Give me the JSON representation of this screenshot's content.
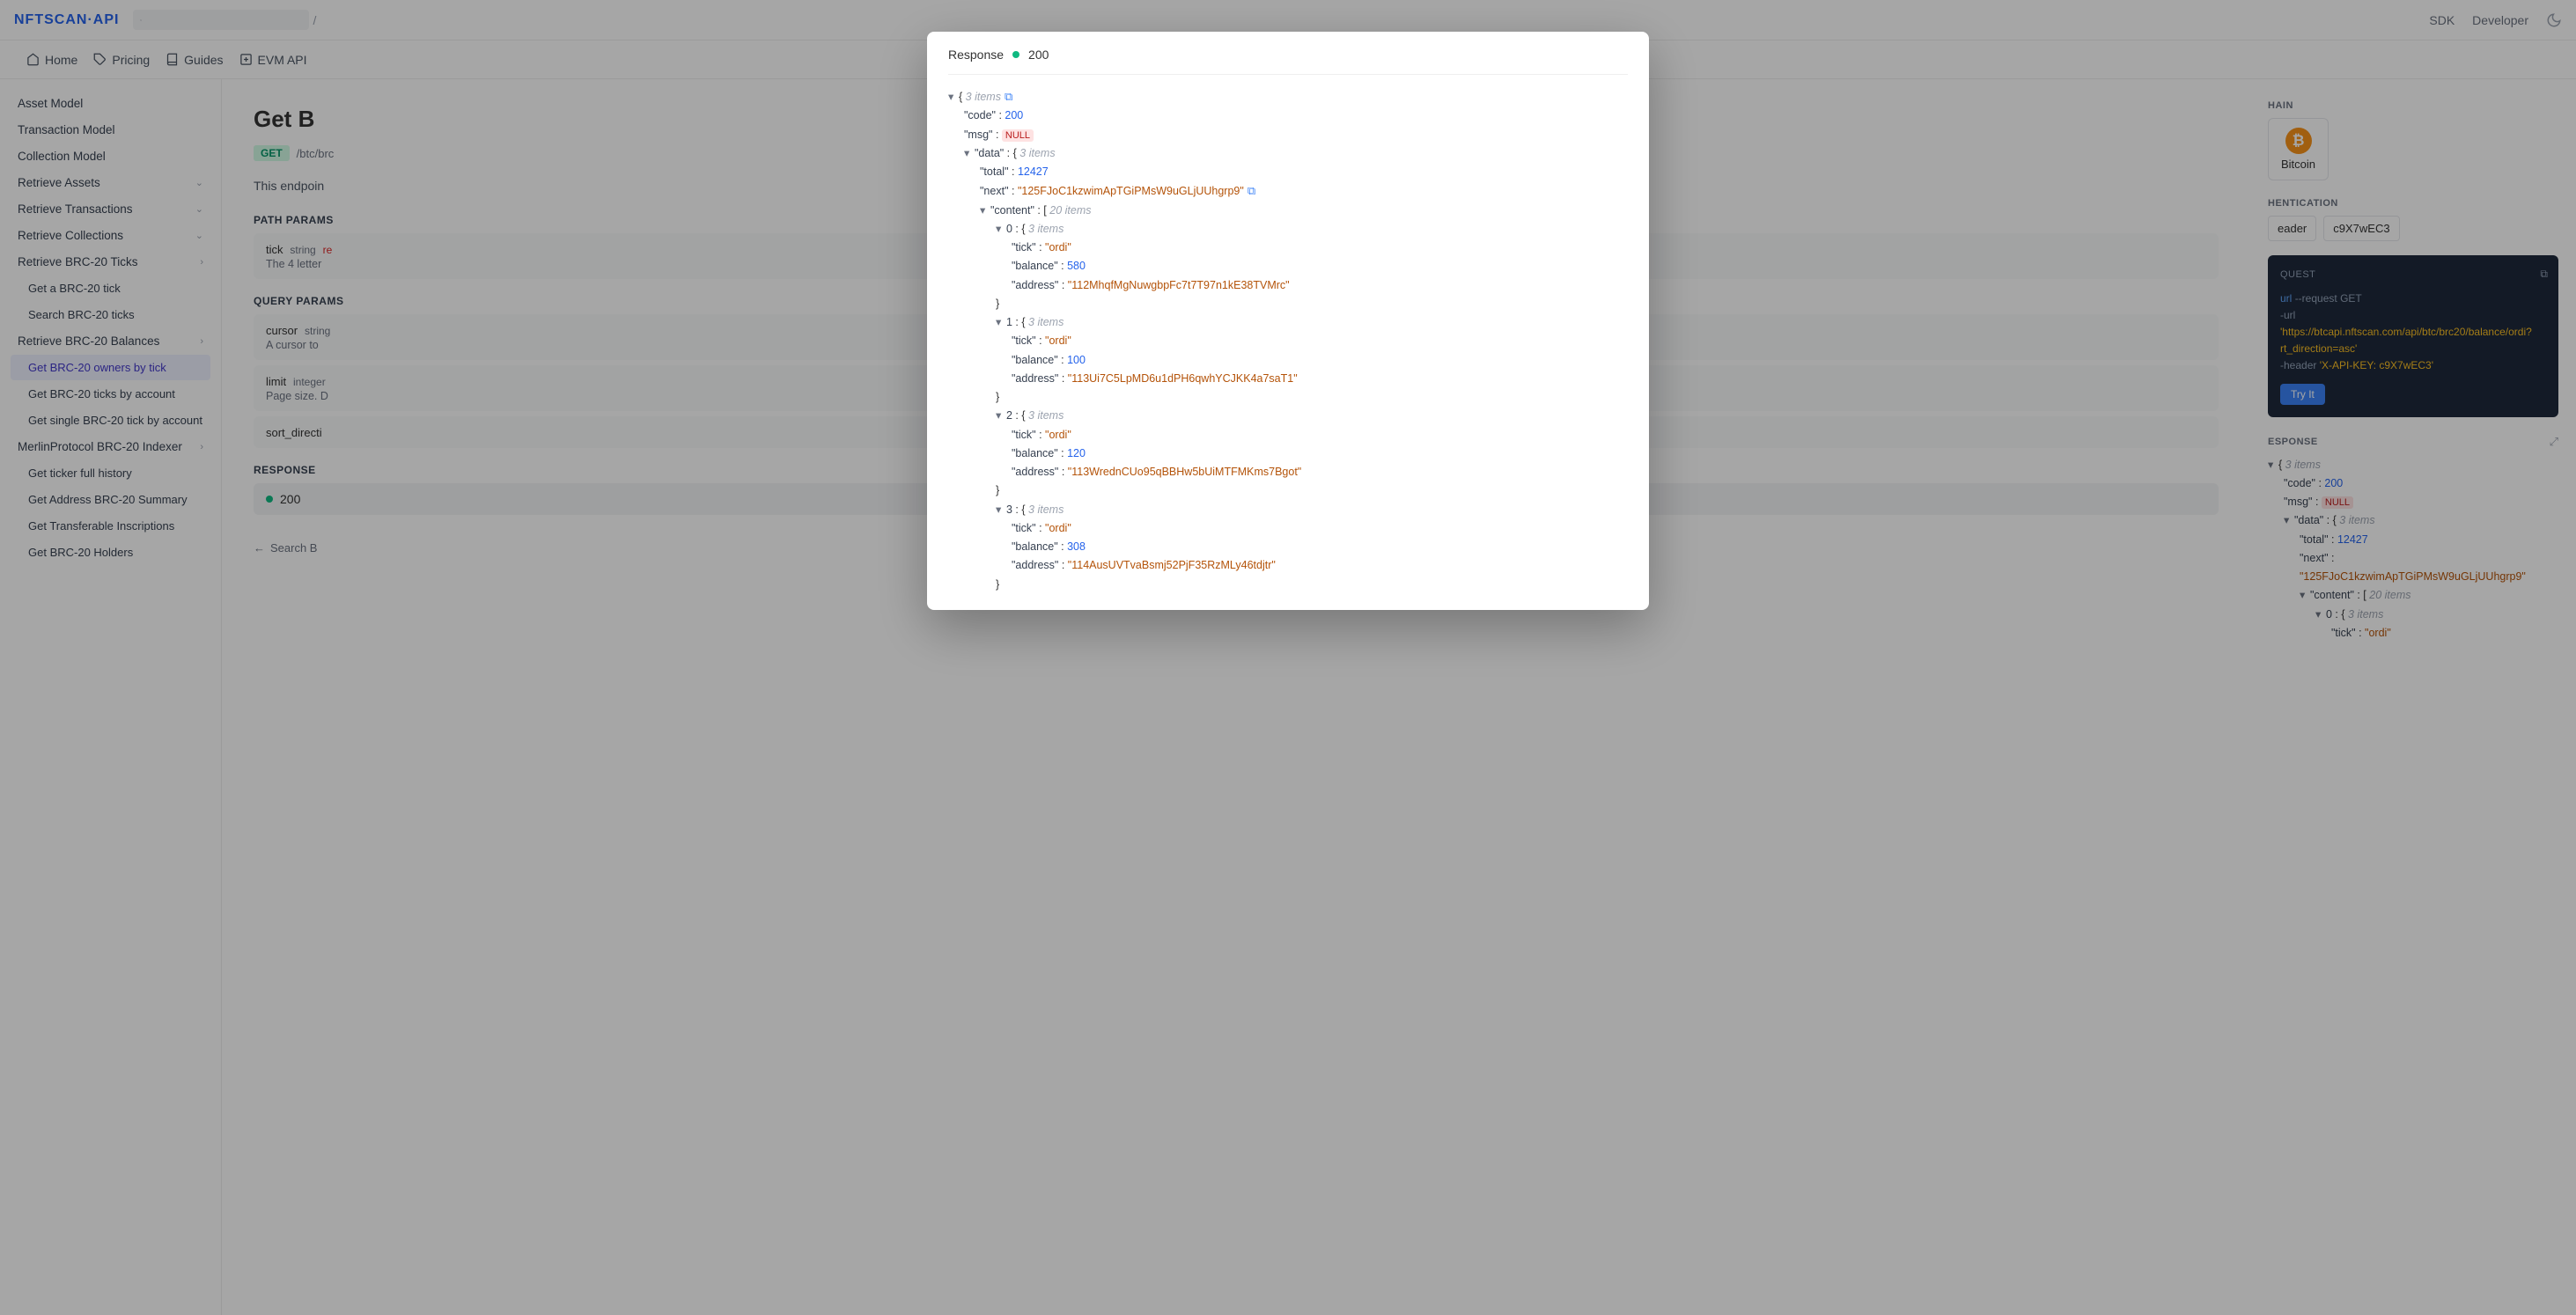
{
  "brand": "NFTSCAN·API",
  "topNav": {
    "sdk": "SDK",
    "developer": "Developer"
  },
  "search": {
    "placeholder": "",
    "slash": "/"
  },
  "tabs": [
    {
      "label": "Home"
    },
    {
      "label": "Pricing"
    },
    {
      "label": "Guides"
    },
    {
      "label": "EVM API"
    }
  ],
  "sidebar": [
    {
      "label": "Asset Model",
      "hdr": true
    },
    {
      "label": "Transaction Model",
      "hdr": true
    },
    {
      "label": "Collection Model",
      "hdr": true
    },
    {
      "label": "Retrieve Assets",
      "hdr": true,
      "chev": "down"
    },
    {
      "label": "Retrieve Transactions",
      "hdr": true,
      "chev": "down"
    },
    {
      "label": "Retrieve Collections",
      "hdr": true,
      "chev": "down"
    },
    {
      "label": "Retrieve BRC-20 Ticks",
      "hdr": true,
      "chev": "right"
    },
    {
      "label": "Get a BRC-20 tick",
      "sub": true
    },
    {
      "label": "Search BRC-20 ticks",
      "sub": true
    },
    {
      "label": "Retrieve BRC-20 Balances",
      "hdr": true,
      "chev": "right"
    },
    {
      "label": "Get BRC-20 owners by tick",
      "sub": true,
      "active": true
    },
    {
      "label": "Get BRC-20 ticks by account",
      "sub": true
    },
    {
      "label": "Get single BRC-20 tick by account",
      "sub": true
    },
    {
      "label": "MerlinProtocol BRC-20 Indexer",
      "hdr": true,
      "chev": "right"
    },
    {
      "label": "Get ticker full history",
      "sub": true
    },
    {
      "label": "Get Address BRC-20 Summary",
      "sub": true
    },
    {
      "label": "Get Transferable Inscriptions",
      "sub": true
    },
    {
      "label": "Get BRC-20 Holders",
      "sub": true
    }
  ],
  "page": {
    "title": "Get B",
    "method": "GET",
    "path": "/btc/brc",
    "desc": "This endpoin",
    "sections": {
      "path": "PATH PARAMS",
      "query": "QUERY PARAMS",
      "response": "RESPONSE"
    },
    "params": {
      "tick": {
        "name": "tick",
        "type": "string",
        "req": "re",
        "desc": "The 4 letter"
      },
      "cursor": {
        "name": "cursor",
        "type": "string",
        "desc": "A cursor to"
      },
      "limit": {
        "name": "limit",
        "type": "integer",
        "desc": "Page size. D"
      },
      "sort": {
        "name": "sort_directi"
      }
    },
    "respCode": "200",
    "updated": "Search B"
  },
  "rightPanel": {
    "chainLabel": "HAIN",
    "chainName": "Bitcoin",
    "authLabel": "HENTICATION",
    "authType": "eader",
    "authKey": "c9X7wEC3",
    "requestLabel": "QUEST",
    "responseLabel": "ESPONSE",
    "tryIt": "Try It",
    "curl": {
      "cmd": "url",
      "flag1": "--request",
      "method": "GET",
      "flag2": "-url",
      "url": "'https://btcapi.nftscan.com/api/btc/brc20/balance/ordi?",
      "url2": "rt_direction=asc'",
      "flag3": "-header",
      "hdr": "'X-API-KEY: c9X7wEC3'"
    }
  },
  "modal": {
    "label": "Response",
    "code": "200"
  },
  "response": {
    "code": 200,
    "msg": null,
    "data": {
      "total": 12427,
      "next": "125FJoC1kzwimApTGiPMsW9uGLjUUhgrp9",
      "content": [
        {
          "tick": "ordi",
          "balance": 580,
          "address": "112MhqfMgNuwgbpFc7t7T97n1kE38TVMrc"
        },
        {
          "tick": "ordi",
          "balance": 100,
          "address": "113Ui7C5LpMD6u1dPH6qwhYCJKK4a7saT1"
        },
        {
          "tick": "ordi",
          "balance": 120,
          "address": "113WrednCUo95qBBHw5bUiMTFMKms7Bgot"
        },
        {
          "tick": "ordi",
          "balance": 308,
          "address": "114AusUVTvaBsmj52PjF35RzMLy46tdjtr"
        }
      ]
    }
  },
  "counts": {
    "root": "3 items",
    "data": "3 items",
    "content": "20 items",
    "item": "3 items"
  }
}
